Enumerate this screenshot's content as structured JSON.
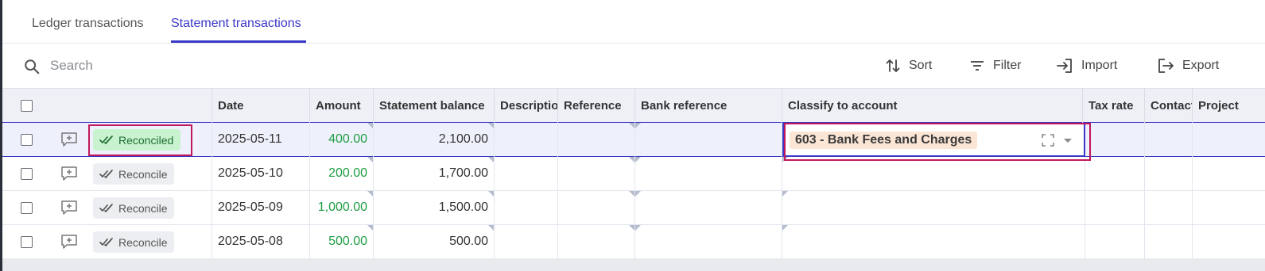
{
  "tabs": {
    "ledger": "Ledger transactions",
    "statement": "Statement transactions",
    "active": "statement"
  },
  "toolbar": {
    "search_placeholder": "Search",
    "sort_label": "Sort",
    "filter_label": "Filter",
    "import_label": "Import",
    "export_label": "Export"
  },
  "columns": {
    "date": "Date",
    "amount": "Amount",
    "statement_balance": "Statement balance",
    "description": "Description",
    "reference": "Reference",
    "bank_reference": "Bank reference",
    "classify": "Classify to account",
    "tax_rate": "Tax rate",
    "contact": "Contact",
    "project": "Project"
  },
  "rows": [
    {
      "status": "Reconciled",
      "date": "2025-05-11",
      "amount": "400.00",
      "balance": "2,100.00",
      "account": "603 - Bank Fees and Charges",
      "selected": true
    },
    {
      "status": "Reconcile",
      "date": "2025-05-10",
      "amount": "200.00",
      "balance": "1,700.00",
      "account": ""
    },
    {
      "status": "Reconcile",
      "date": "2025-05-09",
      "amount": "1,000.00",
      "balance": "1,500.00",
      "account": ""
    },
    {
      "status": "Reconcile",
      "date": "2025-05-08",
      "amount": "500.00",
      "balance": "500.00",
      "account": ""
    }
  ],
  "colors": {
    "accent": "#3a38c7",
    "focus": "#c2185b",
    "positive_amount": "#1f9d43",
    "reconciled_bg": "#c9f3cf",
    "account_chip_bg": "#fbe6d6"
  },
  "icons": [
    "search-icon",
    "sort-icon",
    "filter-icon",
    "import-icon",
    "export-icon",
    "add-note-icon",
    "double-check-icon",
    "expand-icon",
    "chevron-down-icon"
  ]
}
